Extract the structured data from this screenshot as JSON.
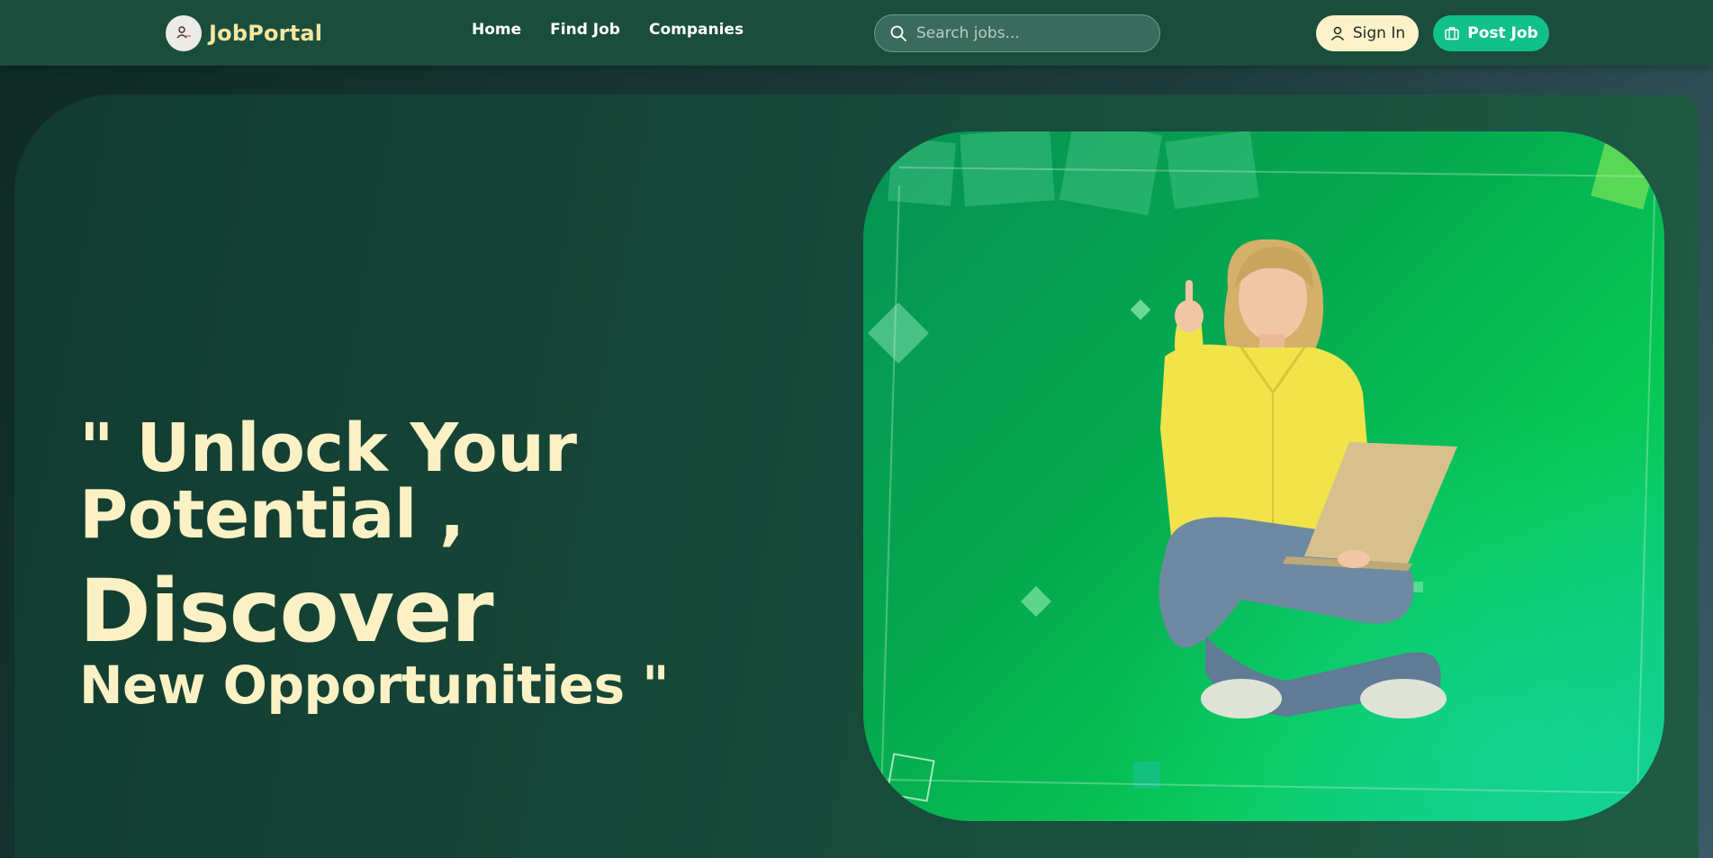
{
  "brand": {
    "name": "JobPortal",
    "logo_icon": "person-logo-icon"
  },
  "nav": {
    "links": [
      {
        "label": "Home"
      },
      {
        "label": "Find Job"
      },
      {
        "label": "Companies"
      }
    ]
  },
  "search": {
    "placeholder": "Search jobs...",
    "icon": "search-icon"
  },
  "actions": {
    "signin_label": "Sign In",
    "post_label": "Post Job"
  },
  "hero": {
    "line1": "\" Unlock Your",
    "line2": "Potential ,",
    "line3": "Discover",
    "line4": "New Opportunities \""
  },
  "colors": {
    "accent": "#12c08a",
    "headline": "#fbf1c4",
    "brand_text": "#f6e6a0",
    "signin_bg": "#fcf1c8"
  }
}
